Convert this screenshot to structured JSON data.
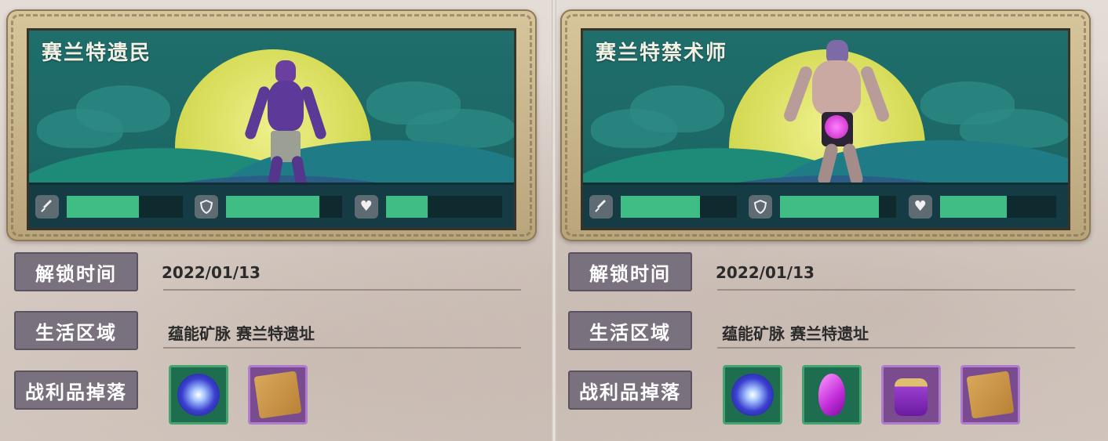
{
  "colors": {
    "stat_bar": "#3fbd84",
    "label_bg": "#79717d",
    "scene_bg": "#1b6b69"
  },
  "panels": [
    {
      "title": "赛兰特遗民",
      "stats": [
        {
          "icon": "sword-icon",
          "fill": 0.62
        },
        {
          "icon": "shield-icon",
          "fill": 0.8
        },
        {
          "icon": "heart-icon",
          "fill": 0.36
        }
      ],
      "unlock_label": "解锁时间",
      "unlock_date": "2022/01/13",
      "region_label": "生活区域",
      "region_value": "蕴能矿脉 赛兰特遗址",
      "loot_label": "战利品掉落",
      "loot": [
        {
          "icon": "starburst-orb-icon",
          "rarity": "green"
        },
        {
          "icon": "parchment-scroll-icon",
          "rarity": "purple"
        }
      ]
    },
    {
      "title": "赛兰特禁术师",
      "stats": [
        {
          "icon": "sword-icon",
          "fill": 0.68
        },
        {
          "icon": "shield-icon",
          "fill": 0.85
        },
        {
          "icon": "heart-icon",
          "fill": 0.58
        }
      ],
      "unlock_label": "解锁时间",
      "unlock_date": "2022/01/13",
      "region_label": "生活区域",
      "region_value": "蕴能矿脉 赛兰特遗址",
      "loot_label": "战利品掉落",
      "loot": [
        {
          "icon": "starburst-orb-icon",
          "rarity": "green"
        },
        {
          "icon": "magenta-crystal-icon",
          "rarity": "green"
        },
        {
          "icon": "potion-bottle-icon",
          "rarity": "purple"
        },
        {
          "icon": "parchment-scroll-icon",
          "rarity": "purple"
        }
      ]
    }
  ]
}
